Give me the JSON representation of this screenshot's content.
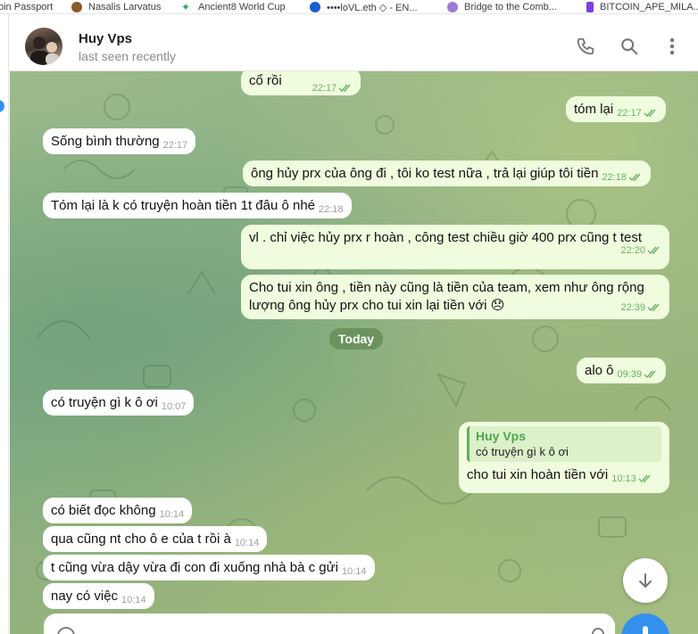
{
  "bookmarks": [
    {
      "label": "oin Passport",
      "icon": "passport-icon",
      "color": "#2b6cd6"
    },
    {
      "label": "Nasalis Larvatus",
      "icon": "monkey-icon",
      "color": "#8a5a2b"
    },
    {
      "label": "Ancient8 World Cup",
      "icon": "star-icon",
      "color": "#2fa84f"
    },
    {
      "label": "••••loVL.eth ◇ - EN...",
      "icon": "ens-icon",
      "color": "#1a5fd0"
    },
    {
      "label": "Bridge to the Comb...",
      "icon": "bridge-icon",
      "color": "#9b7bd4"
    },
    {
      "label": "BITCOIN_APE_MILA...",
      "icon": "bitcoin-icon",
      "color": "#7b3fe4"
    }
  ],
  "header": {
    "name": "Huy Vps",
    "status": "last seen recently"
  },
  "date_separator": "Today",
  "messages": [
    {
      "dir": "out",
      "text": "cổ rồi",
      "time": "22:17"
    },
    {
      "dir": "out",
      "text": "tóm lại",
      "time": "22:17"
    },
    {
      "dir": "in",
      "text": "Sống bình thường",
      "time": "22:17"
    },
    {
      "dir": "out",
      "text": "ông hủy prx của ông đi , tôi ko test nữa , trả lại giúp tôi tiền",
      "time": "22:18"
    },
    {
      "dir": "in",
      "text": "Tóm lại là k có truyện hoàn tiền 1t đâu ô nhé",
      "time": "22:18"
    },
    {
      "dir": "out",
      "text": "vl . chỉ việc hủy prx r hoàn , công test chiều giờ 400 prx cũng t test",
      "time": "22:20"
    },
    {
      "dir": "out",
      "text": "Cho tui xin ông , tiền này cũng là tiền của team, xem như ông rộng lượng ông hủy  prx cho tui xin lại tiền với",
      "emoji": "😞",
      "time": "22:39"
    },
    {
      "dir": "out",
      "text": "alo ô",
      "time": "09:39"
    },
    {
      "dir": "in",
      "text": "có truyện gì k ô ơi",
      "time": "10:07"
    },
    {
      "dir": "out",
      "reply_name": "Huy Vps",
      "reply_text": "có truyện gì k ô ơi",
      "text": "cho tui xin hoàn tiền với",
      "time": "10:13"
    },
    {
      "dir": "in",
      "text": "có biết đọc không",
      "time": "10:14"
    },
    {
      "dir": "in",
      "text": "qua cũng nt cho ô e của t rồi à",
      "time": "10:14"
    },
    {
      "dir": "in",
      "text": "t cũng vừa dậy vừa đi con đi xuống nhà bà c gửi",
      "time": "10:14"
    },
    {
      "dir": "in",
      "text": "nay có việc",
      "time": "10:14"
    }
  ],
  "composer": {
    "placeholder": ""
  },
  "colors": {
    "accent": "#3390ec",
    "outgoing_bubble": "#effdde",
    "incoming_bubble": "#ffffff",
    "tick_green": "#6bb164"
  }
}
